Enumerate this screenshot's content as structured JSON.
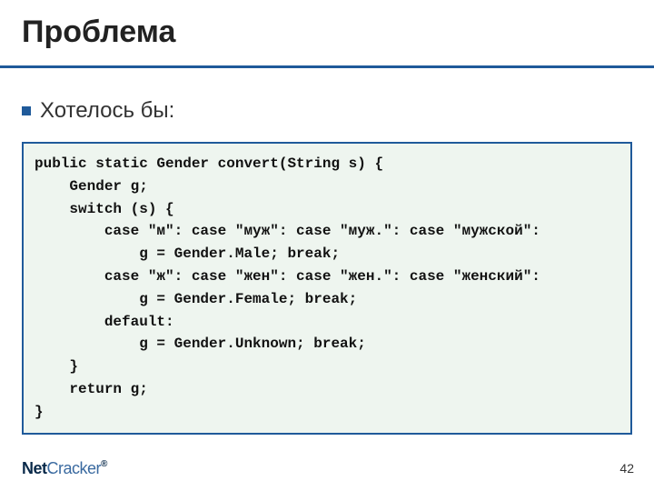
{
  "title": "Проблема",
  "bullet": "Хотелось бы:",
  "code": "public static Gender convert(String s) {\n    Gender g;\n    switch (s) {\n        case \"м\": case \"муж\": case \"муж.\": case \"мужской\":\n            g = Gender.Male; break;\n        case \"ж\": case \"жен\": case \"жен.\": case \"женский\":\n            g = Gender.Female; break;\n        default:\n            g = Gender.Unknown; break;\n    }\n    return g;\n}",
  "footer": {
    "logo_strong": "Net",
    "logo_light": "Cracker",
    "logo_reg": "®",
    "page": "42"
  }
}
